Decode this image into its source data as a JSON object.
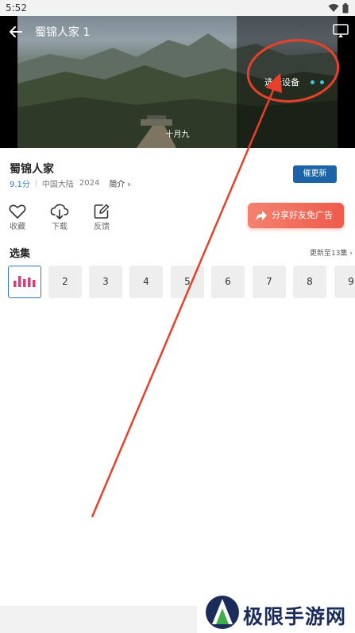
{
  "status_bar": {
    "time": "5:52"
  },
  "player": {
    "title": "蜀锦人家 1",
    "choose_device": "选择设备",
    "subtitle": "十月九"
  },
  "show": {
    "title": "蜀锦人家",
    "score": "9.1分",
    "region": "中国大陆",
    "year": "2024",
    "intro_label": "简介 ›",
    "remind_label": "催更新"
  },
  "actions": [
    {
      "label": "收藏",
      "icon": "heart-icon"
    },
    {
      "label": "下载",
      "icon": "cloud-download-icon"
    },
    {
      "label": "反馈",
      "icon": "edit-icon"
    }
  ],
  "share": {
    "label": "分享好友免广告",
    "icon": "share-arrow-icon"
  },
  "episodes": {
    "title": "选集",
    "update_note": "更新至13集 ›",
    "items": [
      "2",
      "3",
      "4",
      "5",
      "6",
      "7",
      "8",
      "9"
    ],
    "current_icon": "playing-bars-icon"
  },
  "watermark": {
    "text": "极限手游网"
  },
  "colors": {
    "accent_blue": "#1c63a8",
    "score_blue": "#2a77d6",
    "share_red": "#ee5b4b",
    "playing_pink": "#e8347a",
    "annotation_red": "#e8402a"
  }
}
